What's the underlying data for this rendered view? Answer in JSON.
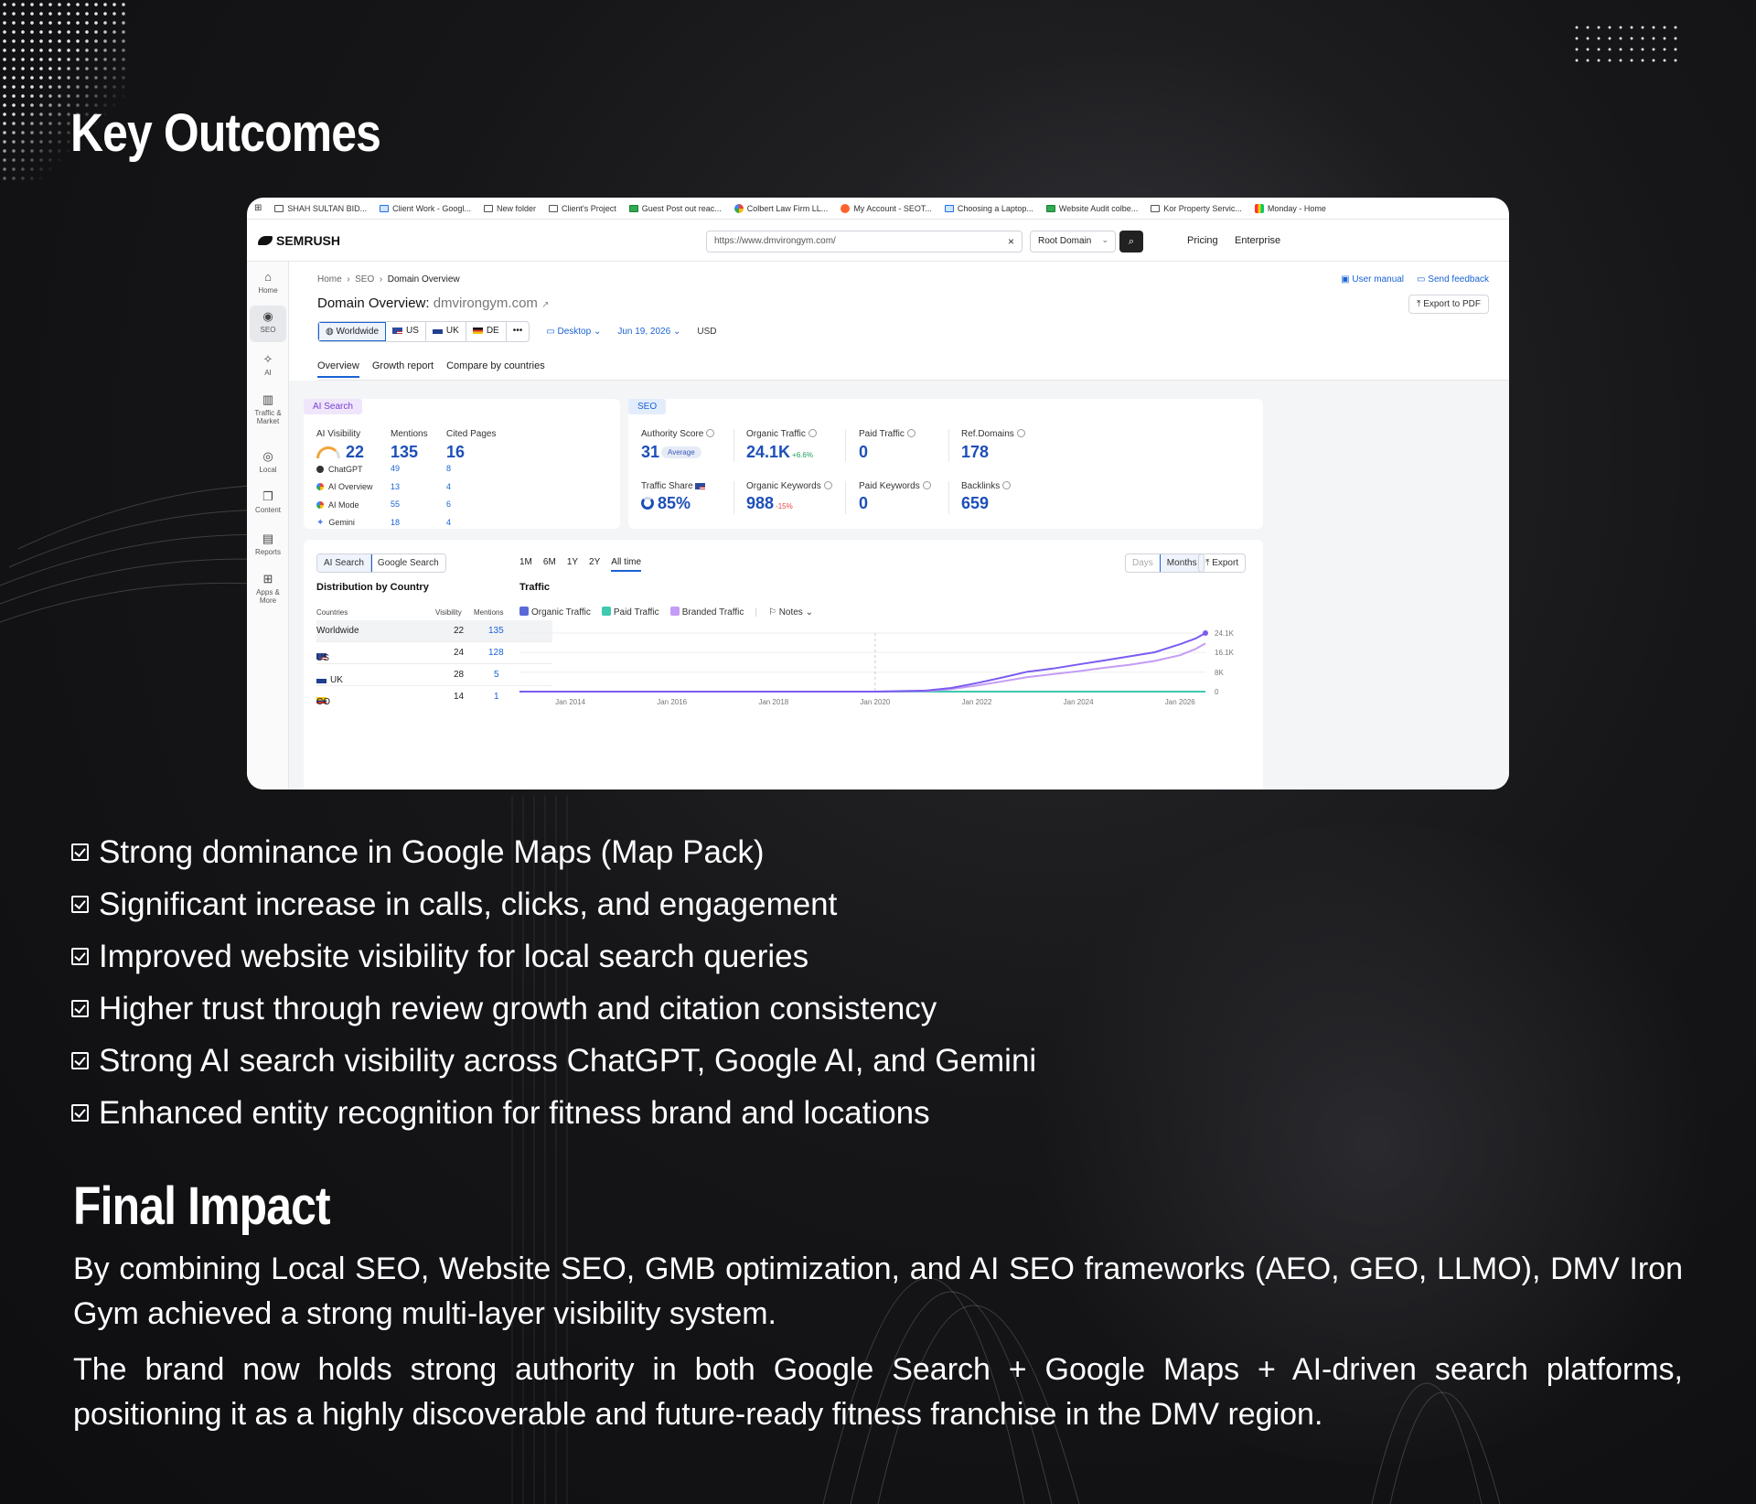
{
  "headings": {
    "key_outcomes": "Key Outcomes",
    "final_impact": "Final Impact"
  },
  "colors": {
    "background": "#161618",
    "text": "#ffffff",
    "semrush_blue": "#1d4fb8",
    "ai_purple": "#7a3fd6",
    "organic_line": "#7b5cf0",
    "branded_line": "#c49cf5",
    "paid_line": "#3ec9b0"
  },
  "bookmarks": [
    {
      "icon": "folder-icon",
      "label": "SHAH SULTAN BID..."
    },
    {
      "icon": "doc-icon",
      "label": "Client Work - Googl..."
    },
    {
      "icon": "folder-icon",
      "label": "New folder"
    },
    {
      "icon": "folder-icon",
      "label": "Client's Project"
    },
    {
      "icon": "sheet-icon",
      "label": "Guest Post out reac..."
    },
    {
      "icon": "google-icon",
      "label": "Colbert Law Firm LL..."
    },
    {
      "icon": "semrush-icon",
      "label": "My Account - SEOT..."
    },
    {
      "icon": "doc-icon",
      "label": "Choosing a Laptop..."
    },
    {
      "icon": "sheet-icon",
      "label": "Website Audit colbe..."
    },
    {
      "icon": "folder-icon",
      "label": "Kor Property Servic..."
    },
    {
      "icon": "monday-icon",
      "label": "Monday - Home"
    }
  ],
  "topbar": {
    "logo": "SEMRUSH",
    "search_value": "https://www.dmvirongym.com/",
    "scope": "Root Domain",
    "pricing": "Pricing",
    "enterprise": "Enterprise"
  },
  "sidebar": [
    {
      "icon": "home-icon",
      "label": "Home"
    },
    {
      "icon": "seo-icon",
      "label": "SEO"
    },
    {
      "icon": "ai-icon",
      "label": "AI"
    },
    {
      "icon": "chart-icon",
      "label": "Traffic & Market"
    },
    {
      "icon": "pin-icon",
      "label": "Local"
    },
    {
      "icon": "content-icon",
      "label": "Content"
    },
    {
      "icon": "reports-icon",
      "label": "Reports"
    },
    {
      "icon": "apps-icon",
      "label": "Apps & More"
    }
  ],
  "breadcrumb": {
    "home": "Home",
    "seo": "SEO",
    "current": "Domain Overview"
  },
  "domain_title": {
    "prefix": "Domain Overview:",
    "domain": "dmvirongym.com"
  },
  "links": {
    "user_manual": "User manual",
    "send_feedback": "Send feedback",
    "export_pdf": "Export to PDF"
  },
  "filters": {
    "worldwide": "Worldwide",
    "us": "US",
    "uk": "UK",
    "de": "DE",
    "more": "•••",
    "device": "Desktop",
    "date": "Jun 19, 2026",
    "currency": "USD"
  },
  "tabs": [
    "Overview",
    "Growth report",
    "Compare by countries"
  ],
  "ai_panel": {
    "pill": "AI Search",
    "visibility_label": "AI Visibility",
    "visibility_value": "22",
    "mentions_label": "Mentions",
    "mentions_value": "135",
    "cited_label": "Cited Pages",
    "cited_value": "16",
    "rows": [
      {
        "name": "ChatGPT",
        "mentions": "49",
        "cited": "8"
      },
      {
        "name": "AI Overview",
        "mentions": "13",
        "cited": "4"
      },
      {
        "name": "AI Mode",
        "mentions": "55",
        "cited": "6"
      },
      {
        "name": "Gemini",
        "mentions": "18",
        "cited": "4"
      }
    ]
  },
  "seo_panel": {
    "pill": "SEO",
    "authority_label": "Authority Score",
    "authority_value": "31",
    "authority_badge": "Average",
    "organic_label": "Organic Traffic",
    "organic_value": "24.1K",
    "organic_delta": "+6.6%",
    "paid_label": "Paid Traffic",
    "paid_value": "0",
    "refdomains_label": "Ref.Domains",
    "refdomains_value": "178",
    "share_label": "Traffic Share",
    "share_value": "85%",
    "keywords_label": "Organic Keywords",
    "keywords_value": "988",
    "keywords_delta": "-15%",
    "paid_kw_label": "Paid Keywords",
    "paid_kw_value": "0",
    "backlinks_label": "Backlinks",
    "backlinks_value": "659"
  },
  "distribution": {
    "toggle": [
      "AI Search",
      "Google Search"
    ],
    "title": "Distribution by Country",
    "columns": {
      "country": "Countries",
      "visibility": "Visibility",
      "mentions": "Mentions"
    },
    "rows": [
      {
        "country": "Worldwide",
        "flag": "",
        "visibility": "22",
        "mentions": "135"
      },
      {
        "country": "US",
        "flag": "us",
        "visibility": "24",
        "mentions": "128"
      },
      {
        "country": "UK",
        "flag": "uk",
        "visibility": "28",
        "mentions": "5"
      },
      {
        "country": "CO",
        "flag": "co",
        "visibility": "14",
        "mentions": "1"
      }
    ]
  },
  "traffic": {
    "time_tabs": [
      "1M",
      "6M",
      "1Y",
      "2Y",
      "All time"
    ],
    "title": "Traffic",
    "legend": [
      "Organic Traffic",
      "Paid Traffic",
      "Branded Traffic"
    ],
    "notes": "Notes",
    "granularity": [
      "Days",
      "Months"
    ],
    "export": "Export"
  },
  "chart_data": {
    "type": "line",
    "title": "Traffic",
    "x_ticks": [
      "Jan 2014",
      "Jan 2016",
      "Jan 2018",
      "Jan 2020",
      "Jan 2022",
      "Jan 2024",
      "Jan 2026"
    ],
    "y_ticks": [
      "24.1K",
      "16.1K",
      "8K",
      "0"
    ],
    "ylim": [
      0,
      24100
    ],
    "xlim": [
      2013.0,
      2026.5
    ],
    "series": [
      {
        "name": "Organic Traffic",
        "color": "#7b5cf0",
        "x": [
          2013.0,
          2020.0,
          2021.0,
          2021.5,
          2022.0,
          2022.5,
          2023.0,
          2023.5,
          2024.0,
          2024.5,
          2025.0,
          2025.5,
          2026.0,
          2026.3,
          2026.5
        ],
        "y": [
          0,
          0,
          400,
          1500,
          3500,
          5800,
          8200,
          9500,
          11200,
          12800,
          14500,
          16200,
          19500,
          21800,
          24100
        ]
      },
      {
        "name": "Branded Traffic",
        "color": "#c49cf5",
        "x": [
          2013.0,
          2020.0,
          2021.0,
          2021.5,
          2022.0,
          2022.5,
          2023.0,
          2023.5,
          2024.0,
          2024.5,
          2025.0,
          2025.5,
          2026.0,
          2026.3,
          2026.5
        ],
        "y": [
          0,
          0,
          200,
          1000,
          2500,
          4200,
          6000,
          7200,
          8400,
          9800,
          11000,
          12600,
          15000,
          17500,
          19800
        ]
      },
      {
        "name": "Paid Traffic",
        "color": "#3ec9b0",
        "x": [
          2013.0,
          2026.5
        ],
        "y": [
          0,
          0
        ]
      }
    ]
  },
  "outcomes": [
    "Strong dominance in Google Maps (Map Pack)",
    "Significant increase in calls, clicks, and engagement",
    "Improved website visibility for local search queries",
    "Higher trust through review growth and citation consistency",
    "Strong AI search visibility across ChatGPT, Google AI, and Gemini",
    "Enhanced entity recognition for fitness brand and locations"
  ],
  "final_impact": [
    "By combining Local SEO, Website SEO, GMB optimization, and AI SEO frameworks (AEO, GEO, LLMO), DMV Iron Gym achieved a strong multi-layer visibility system.",
    "The brand now holds strong authority in both Google Search + Google Maps + AI-driven search platforms, positioning it as a highly discoverable and future-ready fitness franchise in the DMV region."
  ]
}
